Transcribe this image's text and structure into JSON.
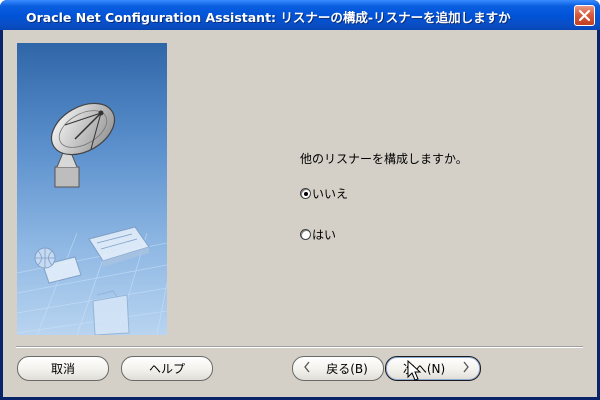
{
  "window": {
    "title": "Oracle Net Configuration Assistant: リスナーの構成-リスナーを追加しますか"
  },
  "icons": {
    "close": "close-x-icon",
    "side": "satellite-dish-network-illustration",
    "back": "chevron-left-icon",
    "next": "chevron-right-icon",
    "cursor": "mouse-pointer-icon"
  },
  "main": {
    "prompt": "他のリスナーを構成しますか。",
    "options": [
      {
        "label": "いいえ",
        "selected": true
      },
      {
        "label": "はい",
        "selected": false
      }
    ]
  },
  "buttons": {
    "cancel": "取消",
    "help": "ヘルプ",
    "back": "戻る(B)",
    "next": "次へ(N)"
  },
  "colors": {
    "title_bar": "#0052d6",
    "close_button": "#d95a3c",
    "dialog_bg": "#d4d0c8",
    "side_panel": "#4f86c6"
  }
}
